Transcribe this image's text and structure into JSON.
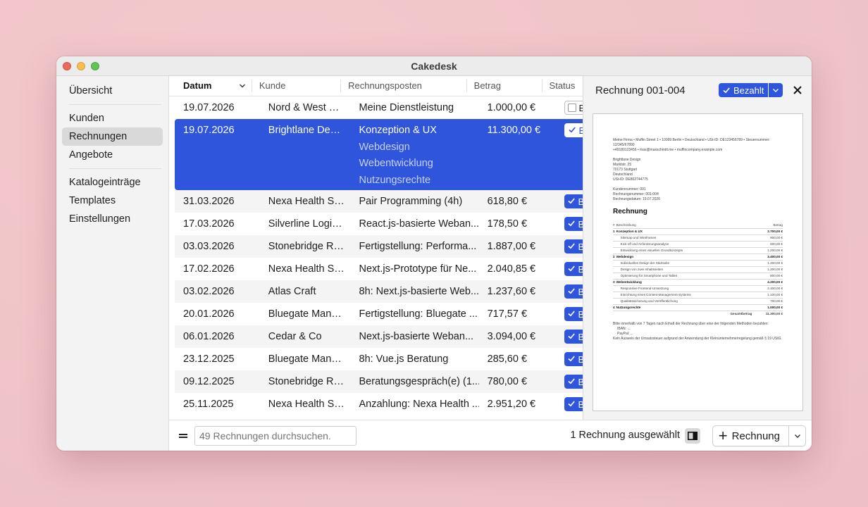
{
  "window": {
    "title": "Cakedesk"
  },
  "sidebar": {
    "groups": [
      [
        {
          "label": "Übersicht"
        }
      ],
      [
        {
          "label": "Kunden"
        },
        {
          "label": "Rechnungen"
        },
        {
          "label": "Angebote"
        }
      ],
      [
        {
          "label": "Katalogeinträge"
        },
        {
          "label": "Templates"
        },
        {
          "label": "Einstellungen"
        }
      ]
    ]
  },
  "table": {
    "columns": {
      "date": "Datum",
      "customer": "Kunde",
      "positions": "Rechnungsposten",
      "amount": "Betrag",
      "status": "Status"
    },
    "rows": [
      {
        "date": "19.07.2026",
        "customer": "Nord & West Co...",
        "positions": [
          "Meine Dienstleistung"
        ],
        "amount": "1.000,00 €",
        "status": "Be",
        "paid": false
      },
      {
        "date": "19.07.2026",
        "customer": "Brightlane Design",
        "positions": [
          "Konzeption & UX",
          "Webdesign",
          "Webentwicklung",
          "Nutzungsrechte"
        ],
        "amount": "11.300,00 €",
        "status": "Be",
        "paid": true,
        "selected": true
      },
      {
        "date": "31.03.2026",
        "customer": "Nexa Health Ser...",
        "positions": [
          "Pair Programming (4h)"
        ],
        "amount": "618,80 €",
        "status": "Be",
        "paid": true
      },
      {
        "date": "17.03.2026",
        "customer": "Silverline Logisti...",
        "positions": [
          "React.js-basierte Weban..."
        ],
        "amount": "178,50 €",
        "status": "Be",
        "paid": true
      },
      {
        "date": "03.03.2026",
        "customer": "Stonebridge Ret...",
        "positions": [
          "Fertigstellung: Performa..."
        ],
        "amount": "1.887,00 €",
        "status": "Be",
        "paid": true
      },
      {
        "date": "17.02.2026",
        "customer": "Nexa Health Ser...",
        "positions": [
          "Next.js-Prototype für Ne..."
        ],
        "amount": "2.040,85 €",
        "status": "Be",
        "paid": true
      },
      {
        "date": "03.02.2026",
        "customer": "Atlas Craft",
        "positions": [
          "8h: Next.js-basierte Web..."
        ],
        "amount": "1.237,60 €",
        "status": "Be",
        "paid": true
      },
      {
        "date": "20.01.2026",
        "customer": "Bluegate Manuf...",
        "positions": [
          "Fertigstellung: Bluegate ..."
        ],
        "amount": "717,57 €",
        "status": "Be",
        "paid": true
      },
      {
        "date": "06.01.2026",
        "customer": "Cedar & Co",
        "positions": [
          "Next.js-basierte Weban..."
        ],
        "amount": "3.094,00 €",
        "status": "Be",
        "paid": true
      },
      {
        "date": "23.12.2025",
        "customer": "Bluegate Manuf...",
        "positions": [
          "8h: Vue.js Beratung"
        ],
        "amount": "285,60 €",
        "status": "Be",
        "paid": true
      },
      {
        "date": "09.12.2025",
        "customer": "Stonebridge Ret...",
        "positions": [
          "Beratungsgespräch(e) (1..."
        ],
        "amount": "780,00 €",
        "status": "Be",
        "paid": true
      },
      {
        "date": "25.11.2025",
        "customer": "Nexa Health Ser...",
        "positions": [
          "Anzahlung: Nexa Health ..."
        ],
        "amount": "2.951,20 €",
        "status": "Be",
        "paid": true
      }
    ]
  },
  "footer": {
    "search_placeholder": "49 Rechnungen durchsuchen.",
    "selection_text": "1 Rechnung ausgewählt",
    "add_label": "Rechnung"
  },
  "detail": {
    "title": "Rechnung 001-004",
    "status_label": "Bezahlt",
    "invoice": {
      "sender_line": "Meine Firma • Muffin Street 1 • 10999 Berlin • Deutschland • USt-ID: DE123456789 • Steuernummer: 12/345/67890",
      "contact_line": "+49180123456 • max@maxschmitt.me • muffincompany.example.com",
      "recipient": [
        "Brightlane Design",
        "Marktstr. 25",
        "70173 Stuttgart",
        "Deutschland",
        "USt-ID: DE802744775"
      ],
      "meta": [
        "Kundennummer: 001",
        "Rechnungsnummer: 001-004",
        "Rechnungsdatum: 19.07.2026"
      ],
      "heading": "Rechnung",
      "col_desc": "Beschreibung",
      "col_amount": "Betrag",
      "items": [
        {
          "no": "1",
          "label": "Konzeption & UX",
          "amount": "2.700,00 €",
          "subs": [
            {
              "label": "Sitemap und Wireframes",
              "amount": "900,00 €"
            },
            {
              "label": "Kick-off und Anforderungsanalyse",
              "amount": "600,00 €"
            },
            {
              "label": "Entwicklung eines visuellen Grundkonzepts",
              "amount": "1.200,00 €"
            }
          ]
        },
        {
          "no": "2",
          "label": "Webdesign",
          "amount": "3.400,00 €",
          "subs": [
            {
              "label": "Individuelles Design der Startseite",
              "amount": "1.400,00 €"
            },
            {
              "label": "Design von zwei Inhaltsseiten",
              "amount": "1.200,00 €"
            },
            {
              "label": "Optimierung für Smartphone und Tablet",
              "amount": "800,00 €"
            }
          ]
        },
        {
          "no": "3",
          "label": "Webentwicklung",
          "amount": "4.200,00 €",
          "subs": [
            {
              "label": "Responsive Frontend-Umsetzung",
              "amount": "2.400,00 €"
            },
            {
              "label": "Einrichtung eines Content-Management-Systems",
              "amount": "1.100,00 €"
            },
            {
              "label": "Qualitätssicherung und Veröffentlichung",
              "amount": "700,00 €"
            }
          ]
        },
        {
          "no": "4",
          "label": "Nutzungsrechte",
          "amount": "1.000,00 €",
          "subs": []
        }
      ],
      "total_label": "Gesamtbetrag",
      "total": "11.300,00 €",
      "payment_note": "Bitte innerhalb von 7 Tagen nach Erhalt der Rechnung über eine der folgenden Methoden bezahlen:",
      "methods": [
        "IBAN: ...",
        "PayPal: ..."
      ],
      "tax_note": "Kein Ausweis der Umsatzsteuer aufgrund der Anwendung der Kleinunternehmerregelung gemäß § 19 UStG."
    }
  },
  "colors": {
    "accent": "#2f55dc"
  }
}
